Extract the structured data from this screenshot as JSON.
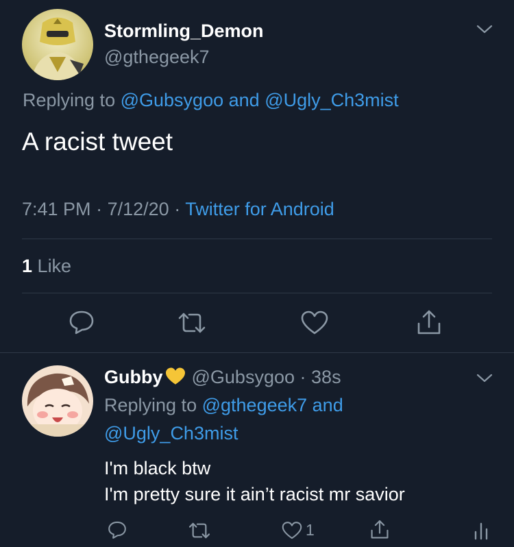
{
  "tweet": {
    "display_name": "Stormling_Demon",
    "handle": "@gthegeek7",
    "replying_prefix": "Replying to",
    "replying_user1": "@Gubsygoo",
    "replying_and": "and",
    "replying_user2": "@Ugly_Ch3mist",
    "text": "A racist tweet",
    "time": "7:41 PM",
    "sep": "·",
    "date": "7/12/20",
    "source": "Twitter for Android",
    "likes_count": "1",
    "likes_label": "Like"
  },
  "reply": {
    "display_name": "Gubby",
    "handle": "@Gubsygoo",
    "sep": "·",
    "age": "38s",
    "replying_prefix": "Replying to",
    "replying_user1": "@gthegeek7",
    "replying_and": "and",
    "replying_user2": "@Ugly_Ch3mist",
    "line1": "I'm black btw",
    "line2": "I'm pretty sure it ain’t racist mr savior",
    "like_count": "1"
  },
  "icons": {
    "reply": "reply-icon",
    "retweet": "retweet-icon",
    "like": "heart-icon",
    "share": "share-icon",
    "chevron": "chevron-down-icon",
    "analytics": "analytics-icon",
    "badge": "yellow-heart-emoji"
  },
  "colors": {
    "background": "#151d2a",
    "accent": "#3f9ce8",
    "secondary_text": "#8b98a5",
    "divider": "#2f3a48"
  }
}
